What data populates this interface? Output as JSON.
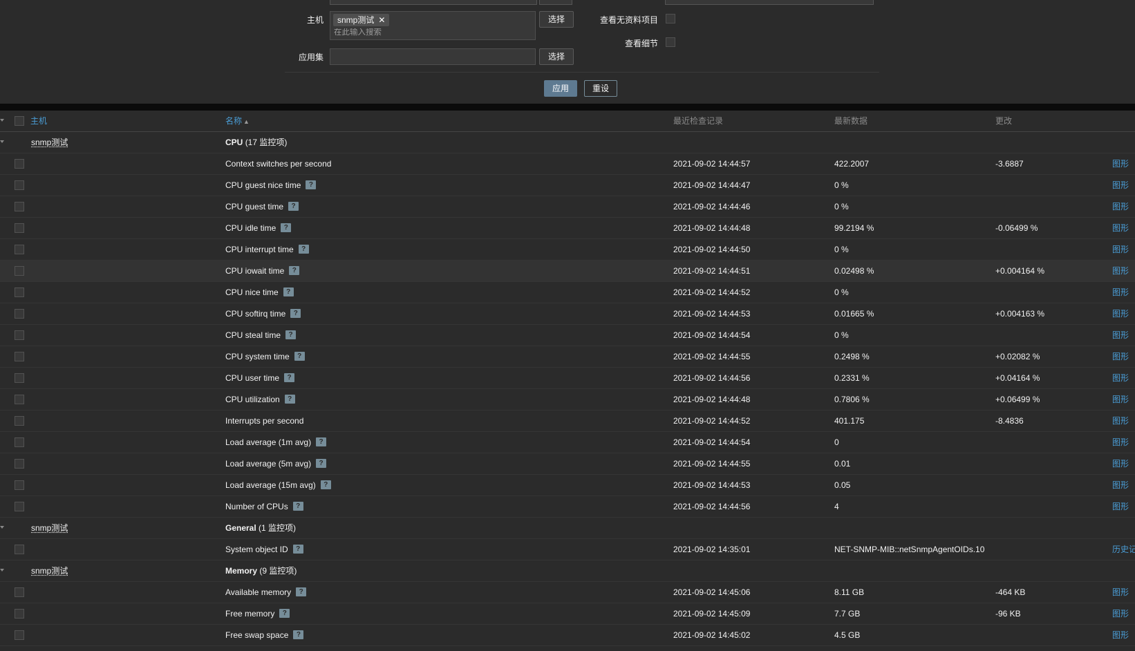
{
  "filter": {
    "host_label": "主机",
    "host_tag": "snmp测试",
    "host_search_placeholder": "在此输入搜索",
    "select_label": "选择",
    "app_label": "应用集",
    "show_no_data_label": "查看无资料项目",
    "show_details_label": "查看细节",
    "apply_label": "应用",
    "reset_label": "重设"
  },
  "table": {
    "headers": {
      "host": "主机",
      "name": "名称",
      "last_check": "最近检查记录",
      "last_value": "最新数据",
      "change": "更改"
    },
    "graph_label": "图形",
    "history_label": "历史记",
    "groups": [
      {
        "host": "snmp测试",
        "app_name": "CPU",
        "app_count": "(17 监控项)",
        "rows": [
          {
            "name": "Context switches per second",
            "hint": false,
            "time": "2021-09-02 14:44:57",
            "value": "422.2007",
            "change": "-3.6887",
            "link": "graph"
          },
          {
            "name": "CPU guest nice time",
            "hint": true,
            "time": "2021-09-02 14:44:47",
            "value": "0 %",
            "change": "",
            "link": "graph"
          },
          {
            "name": "CPU guest time",
            "hint": true,
            "time": "2021-09-02 14:44:46",
            "value": "0 %",
            "change": "",
            "link": "graph"
          },
          {
            "name": "CPU idle time",
            "hint": true,
            "time": "2021-09-02 14:44:48",
            "value": "99.2194 %",
            "change": "-0.06499 %",
            "link": "graph"
          },
          {
            "name": "CPU interrupt time",
            "hint": true,
            "time": "2021-09-02 14:44:50",
            "value": "0 %",
            "change": "",
            "link": "graph"
          },
          {
            "name": "CPU iowait time",
            "hint": true,
            "time": "2021-09-02 14:44:51",
            "value": "0.02498 %",
            "change": "+0.004164 %",
            "link": "graph",
            "highlight": true
          },
          {
            "name": "CPU nice time",
            "hint": true,
            "time": "2021-09-02 14:44:52",
            "value": "0 %",
            "change": "",
            "link": "graph"
          },
          {
            "name": "CPU softirq time",
            "hint": true,
            "time": "2021-09-02 14:44:53",
            "value": "0.01665 %",
            "change": "+0.004163 %",
            "link": "graph"
          },
          {
            "name": "CPU steal time",
            "hint": true,
            "time": "2021-09-02 14:44:54",
            "value": "0 %",
            "change": "",
            "link": "graph"
          },
          {
            "name": "CPU system time",
            "hint": true,
            "time": "2021-09-02 14:44:55",
            "value": "0.2498 %",
            "change": "+0.02082 %",
            "link": "graph"
          },
          {
            "name": "CPU user time",
            "hint": true,
            "time": "2021-09-02 14:44:56",
            "value": "0.2331 %",
            "change": "+0.04164 %",
            "link": "graph"
          },
          {
            "name": "CPU utilization",
            "hint": true,
            "time": "2021-09-02 14:44:48",
            "value": "0.7806 %",
            "change": "+0.06499 %",
            "link": "graph"
          },
          {
            "name": "Interrupts per second",
            "hint": false,
            "time": "2021-09-02 14:44:52",
            "value": "401.175",
            "change": "-8.4836",
            "link": "graph"
          },
          {
            "name": "Load average (1m avg)",
            "hint": true,
            "time": "2021-09-02 14:44:54",
            "value": "0",
            "change": "",
            "link": "graph"
          },
          {
            "name": "Load average (5m avg)",
            "hint": true,
            "time": "2021-09-02 14:44:55",
            "value": "0.01",
            "change": "",
            "link": "graph"
          },
          {
            "name": "Load average (15m avg)",
            "hint": true,
            "time": "2021-09-02 14:44:53",
            "value": "0.05",
            "change": "",
            "link": "graph"
          },
          {
            "name": "Number of CPUs",
            "hint": true,
            "time": "2021-09-02 14:44:56",
            "value": "4",
            "change": "",
            "link": "graph"
          }
        ]
      },
      {
        "host": "snmp测试",
        "app_name": "General",
        "app_count": "(1 监控项)",
        "rows": [
          {
            "name": "System object ID",
            "hint": true,
            "time": "2021-09-02 14:35:01",
            "value": "NET-SNMP-MIB::netSnmpAgentOIDs.10",
            "change": "",
            "link": "history"
          }
        ]
      },
      {
        "host": "snmp测试",
        "app_name": "Memory",
        "app_count": "(9 监控项)",
        "rows": [
          {
            "name": "Available memory",
            "hint": true,
            "time": "2021-09-02 14:45:06",
            "value": "8.11 GB",
            "change": "-464 KB",
            "link": "graph"
          },
          {
            "name": "Free memory",
            "hint": true,
            "time": "2021-09-02 14:45:09",
            "value": "7.7 GB",
            "change": "-96 KB",
            "link": "graph"
          },
          {
            "name": "Free swap space",
            "hint": true,
            "time": "2021-09-02 14:45:02",
            "value": "4.5 GB",
            "change": "",
            "link": "graph"
          }
        ]
      }
    ]
  }
}
